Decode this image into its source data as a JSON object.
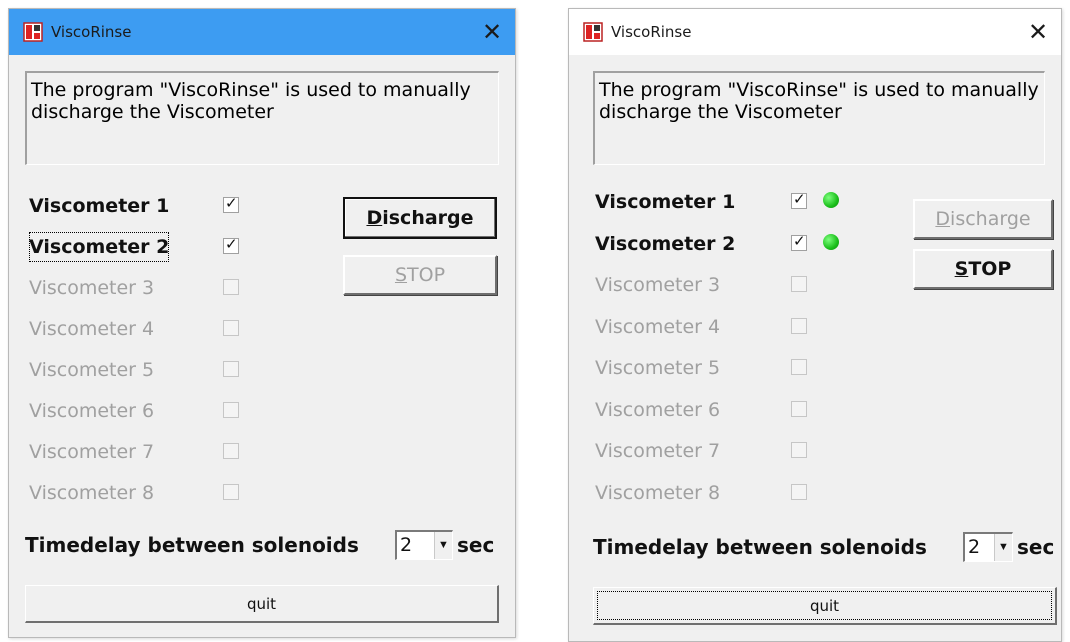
{
  "colors": {
    "titlebar": "#3d9cf2",
    "dialog_bg": "#f0f0f0",
    "disabled_text": "#a0a0a0",
    "led_on": "#1bbf1b"
  },
  "left_window": {
    "title": "ViscoRinse",
    "close_glyph": "✕",
    "description": "The program \"ViscoRinse\" is used to manually discharge the Viscometer",
    "viscometers": [
      {
        "label": "Viscometer 1",
        "checked": true,
        "enabled": true,
        "focused": false
      },
      {
        "label": "Viscometer 2",
        "checked": true,
        "enabled": true,
        "focused": true
      },
      {
        "label": "Viscometer 3",
        "checked": false,
        "enabled": false,
        "focused": false
      },
      {
        "label": "Viscometer 4",
        "checked": false,
        "enabled": false,
        "focused": false
      },
      {
        "label": "Viscometer 5",
        "checked": false,
        "enabled": false,
        "focused": false
      },
      {
        "label": "Viscometer 6",
        "checked": false,
        "enabled": false,
        "focused": false
      },
      {
        "label": "Viscometer 7",
        "checked": false,
        "enabled": false,
        "focused": false
      },
      {
        "label": "Viscometer 8",
        "checked": false,
        "enabled": false,
        "focused": false
      }
    ],
    "discharge_first": "D",
    "discharge_rest": "ischarge",
    "stop_first": "S",
    "stop_rest": "TOP",
    "timedelay_label": "Timedelay between solenoids",
    "timedelay_value": "2",
    "timedelay_unit": "sec",
    "quit_label": "quit"
  },
  "right_window": {
    "title": "ViscoRinse",
    "close_glyph": "✕",
    "description": "The program \"ViscoRinse\" is used to manually discharge the Viscometer",
    "viscometers": [
      {
        "label": "Viscometer 1",
        "checked": true,
        "enabled": true,
        "led": "on"
      },
      {
        "label": "Viscometer 2",
        "checked": true,
        "enabled": true,
        "led": "on"
      },
      {
        "label": "Viscometer 3",
        "checked": false,
        "enabled": false,
        "led": ""
      },
      {
        "label": "Viscometer 4",
        "checked": false,
        "enabled": false,
        "led": ""
      },
      {
        "label": "Viscometer 5",
        "checked": false,
        "enabled": false,
        "led": ""
      },
      {
        "label": "Viscometer 6",
        "checked": false,
        "enabled": false,
        "led": ""
      },
      {
        "label": "Viscometer 7",
        "checked": false,
        "enabled": false,
        "led": ""
      },
      {
        "label": "Viscometer 8",
        "checked": false,
        "enabled": false,
        "led": ""
      }
    ],
    "discharge_first": "D",
    "discharge_rest": "ischarge",
    "stop_first": "S",
    "stop_rest": "TOP",
    "timedelay_label": "Timedelay between solenoids",
    "timedelay_value": "2",
    "timedelay_unit": "sec",
    "quit_label": "quit"
  }
}
